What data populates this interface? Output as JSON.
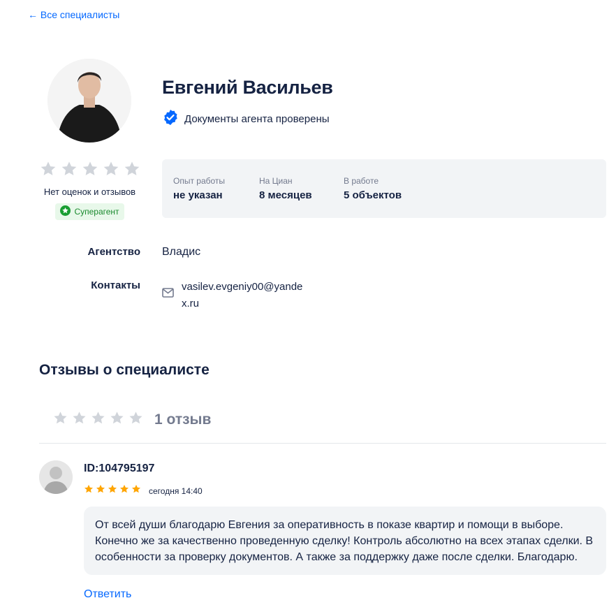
{
  "nav": {
    "back_label": "← Все специалисты"
  },
  "agent": {
    "name": "Евгений Васильев",
    "verified_text": "Документы агента проверены",
    "rating_text": "Нет оценок и отзывов",
    "rating_stars": 0,
    "badge": "Суперагент"
  },
  "stats": [
    {
      "label": "Опыт работы",
      "value": "не указан"
    },
    {
      "label": "На Циан",
      "value": "8 месяцев"
    },
    {
      "label": "В работе",
      "value": "5 объектов"
    }
  ],
  "info": {
    "agency_label": "Агентство",
    "agency_value": "Владис",
    "contacts_label": "Контакты",
    "email": "vasilev.evgeniy00@yandex.ru"
  },
  "reviews": {
    "title": "Отзывы о специалисте",
    "count_label": "1 отзыв",
    "summary_stars": 0,
    "items": [
      {
        "reviewer_id": "ID:104795197",
        "stars": 5,
        "date": "сегодня 14:40",
        "text": "От всей души благодарю Евгения за оперативность в показе квартир и помощи в выборе. Конечно же за качественно проведенную сделку! Контроль абсолютно на всех этапах сделки. В особенности за проверку документов. А также за поддержку даже после сделки. Благодарю.",
        "reply_label": "Ответить"
      }
    ]
  },
  "colors": {
    "accent": "#0468ff",
    "star_empty": "#d0d4da",
    "star_filled": "#ffa500",
    "badge_green": "#1a8a2e",
    "verified_blue": "#0468ff"
  },
  "icons": [
    "verified-badge-icon",
    "star-icon",
    "superagent-star-icon",
    "envelope-icon",
    "user-placeholder-icon"
  ]
}
